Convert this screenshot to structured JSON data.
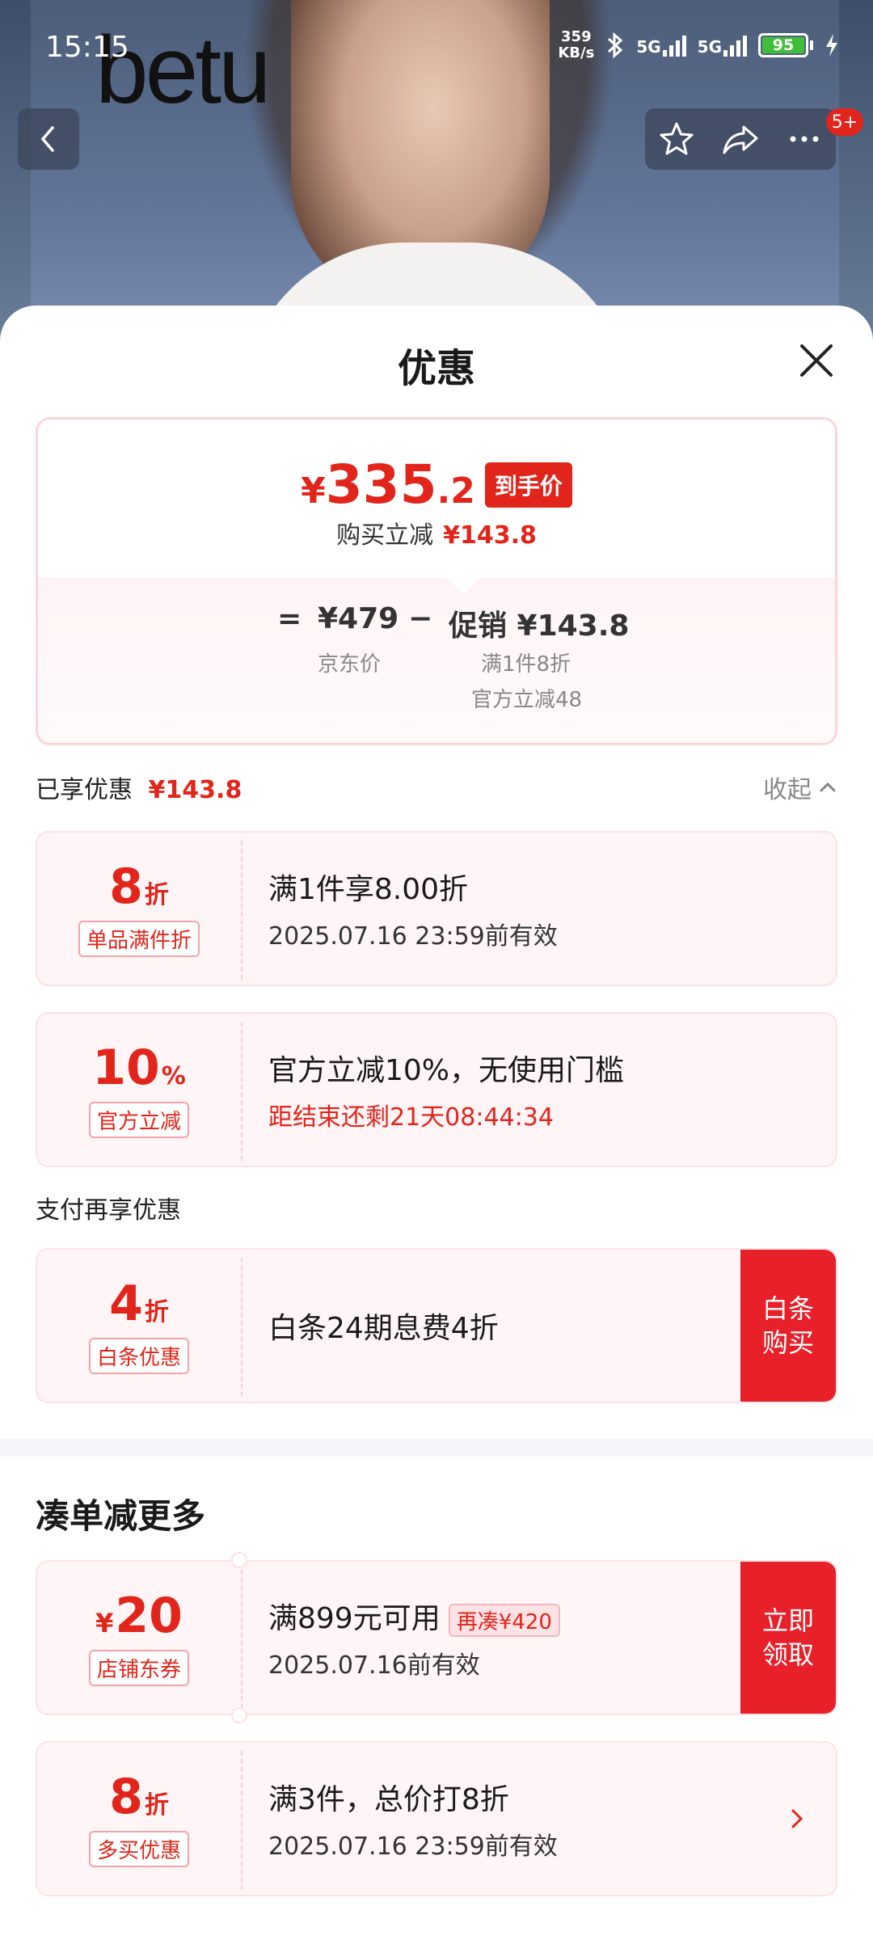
{
  "status": {
    "time": "15:15",
    "net_speed_value": "359",
    "net_speed_unit": "KB/s",
    "sig1": "5G",
    "sig2": "5G",
    "battery": "95"
  },
  "hero": {
    "brand": "betu",
    "more_badge": "5+"
  },
  "sheet": {
    "title": "优惠",
    "summary": {
      "currency": "¥",
      "final_int": "335",
      "final_dec": ".2",
      "final_tag": "到手价",
      "instant_label": "购买立减",
      "instant_value": "¥143.8",
      "eq": "=",
      "jd_price": "¥479",
      "jd_label": "京东价",
      "minus": "−",
      "promo_value": "促销 ¥143.8",
      "promo_line1": "满1件8折",
      "promo_line2": "官方立减48"
    },
    "enjoyed": {
      "label": "已享优惠",
      "value": "¥143.8",
      "collapse": "收起"
    },
    "coupons": [
      {
        "num": "8",
        "unit": "折",
        "chip": "单品满件折",
        "title": "满1件享8.00折",
        "sub": "2025.07.16 23:59前有效"
      },
      {
        "num": "10",
        "unit": "%",
        "chip": "官方立减",
        "title": "官方立减10%，无使用门槛",
        "sub": "距结束还剩21天08:44:34"
      }
    ],
    "pay_label": "支付再享优惠",
    "pay_coupon": {
      "num": "4",
      "unit": "折",
      "chip": "白条优惠",
      "title": "白条24期息费4折",
      "cta": "白条\n购买"
    },
    "more_title": "凑单减更多",
    "store_coupon": {
      "cur": "¥",
      "num": "20",
      "chip": "店铺东券",
      "title": "满899元可用",
      "tag": "再凑¥420",
      "sub": "2025.07.16前有效",
      "cta": "立即\n领取"
    },
    "multi_coupon": {
      "num": "8",
      "unit": "折",
      "chip": "多买优惠",
      "title": "满3件，总价打8折",
      "sub": "2025.07.16 23:59前有效"
    }
  },
  "colors": {
    "accent": "#e1251b",
    "card_bg": "#fff5f6",
    "card_border": "#fce2e4"
  },
  "icons": [
    "back-icon",
    "star-icon",
    "share-icon",
    "more-icon",
    "close-icon",
    "chevron-up-icon",
    "chevron-right-icon",
    "bluetooth-icon",
    "charging-icon"
  ]
}
